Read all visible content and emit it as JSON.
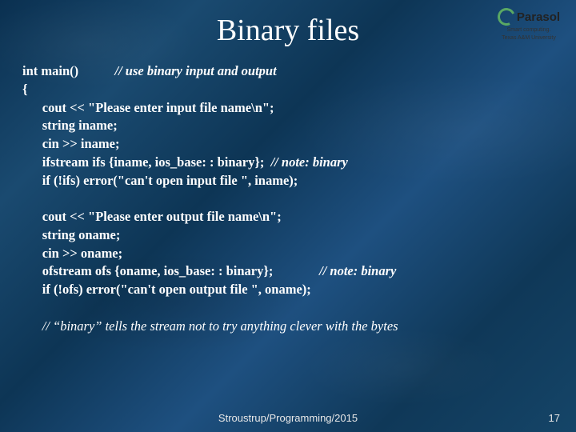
{
  "title": "Binary files",
  "logo": {
    "brand": "Parasol",
    "tagline1": "Smart computing.",
    "tagline2": "Texas A&M University"
  },
  "code": {
    "l1a": "int main()",
    "l1b": "// use binary input and output",
    "l2": "{",
    "l3": "cout << \"Please enter input file name\\n\";",
    "l4": "string iname;",
    "l5": "cin >> iname;",
    "l6a": "ifstream ifs {iname, ios_base: : binary};",
    "l6b": "// note: binary",
    "l7": "if (!ifs) error(\"can't open input file \", iname);",
    "l8": "cout << \"Please enter output file name\\n\";",
    "l9": "string oname;",
    "l10": "cin >> oname;",
    "l11a": "ofstream ofs {oname, ios_base: : binary};",
    "l11b": "// note: binary",
    "l12": "if (!ofs) error(\"can't open output file \", oname);",
    "l13": "// “binary” tells the stream not to try anything clever with the bytes"
  },
  "footer": "Stroustrup/Programming/2015",
  "page": "17"
}
